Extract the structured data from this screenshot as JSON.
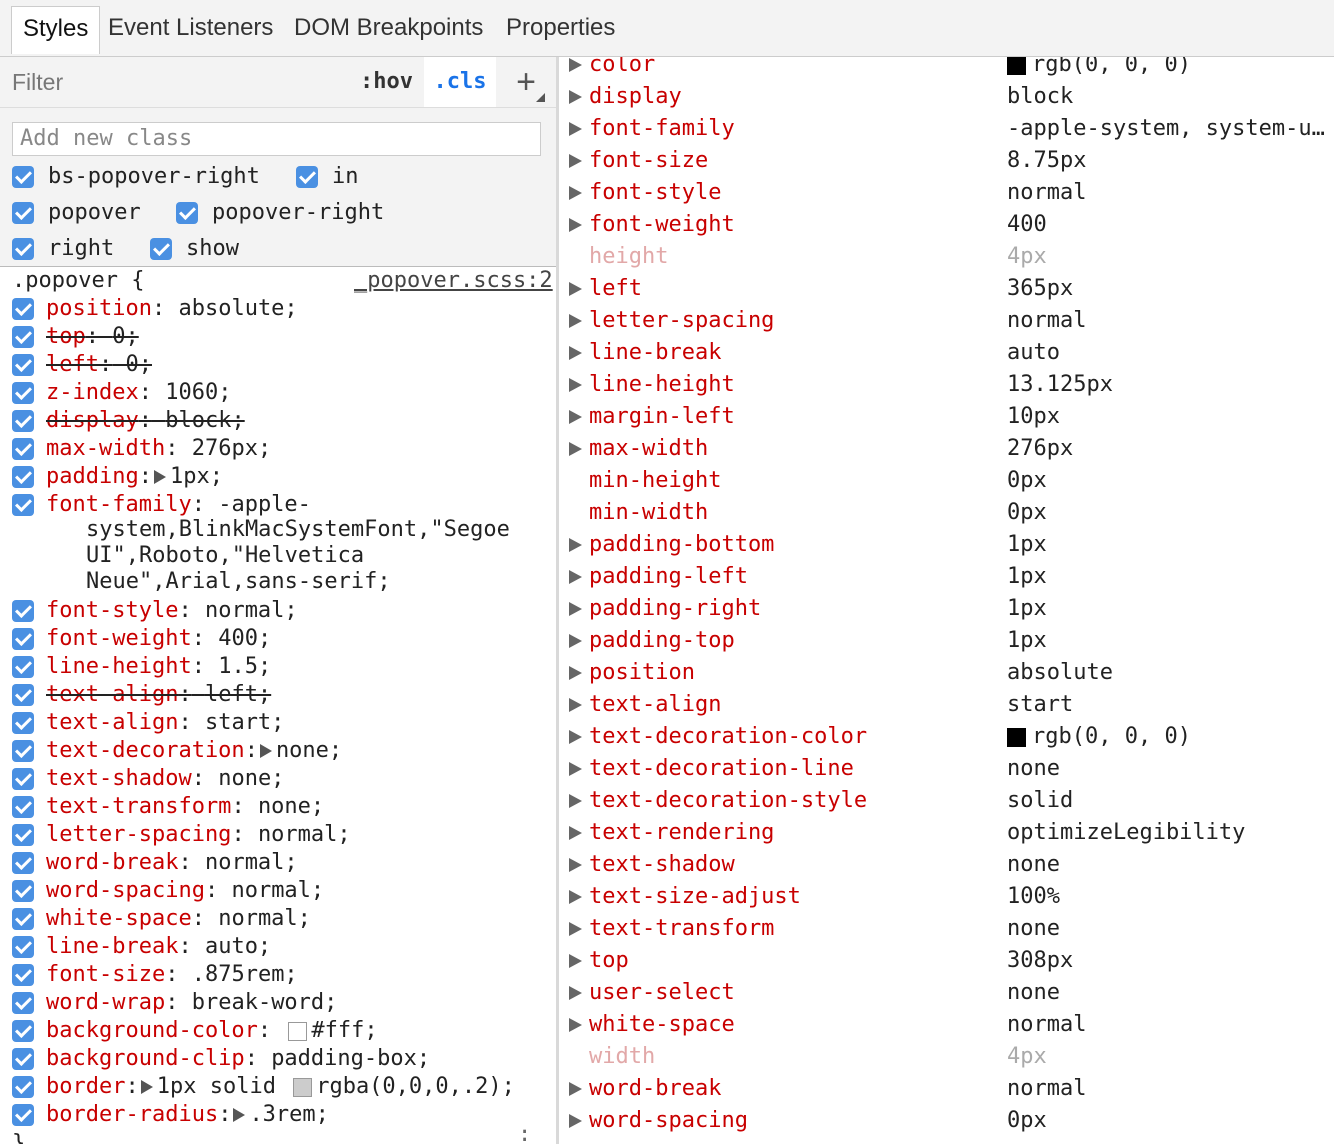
{
  "tabs": [
    {
      "label": "Styles",
      "active": true
    },
    {
      "label": "Event Listeners",
      "active": false
    },
    {
      "label": "DOM Breakpoints",
      "active": false
    },
    {
      "label": "Properties",
      "active": false
    }
  ],
  "toolbar": {
    "filter_placeholder": "Filter",
    "hov_label": ":hov",
    "cls_label": ".cls",
    "add_label": "+"
  },
  "class_pane": {
    "input_placeholder": "Add new class",
    "classes": [
      {
        "name": "bs-popover-right",
        "checked": true
      },
      {
        "name": "in",
        "checked": true
      },
      {
        "name": "popover",
        "checked": true
      },
      {
        "name": "popover-right",
        "checked": true
      },
      {
        "name": "right",
        "checked": true
      },
      {
        "name": "show",
        "checked": true
      }
    ]
  },
  "rule": {
    "selector": ".popover {",
    "source": "_popover.scss:2",
    "close": "}",
    "declarations": [
      {
        "name": "position",
        "value": "absolute;",
        "strike": false
      },
      {
        "name": "top",
        "value": "0;",
        "strike": true
      },
      {
        "name": "left",
        "value": "0;",
        "strike": true
      },
      {
        "name": "z-index",
        "value": "1060;",
        "strike": false
      },
      {
        "name": "display",
        "value": "block;",
        "strike": true
      },
      {
        "name": "max-width",
        "value": "276px;",
        "strike": false
      },
      {
        "name": "padding",
        "value": "1px;",
        "strike": false,
        "expand": true
      },
      {
        "name": "font-family",
        "value": "-apple-",
        "strike": false,
        "cont": [
          "system,BlinkMacSystemFont,\"Segoe",
          "UI\",Roboto,\"Helvetica",
          "Neue\",Arial,sans-serif;"
        ]
      },
      {
        "name": "font-style",
        "value": "normal;",
        "strike": false
      },
      {
        "name": "font-weight",
        "value": "400;",
        "strike": false
      },
      {
        "name": "line-height",
        "value": "1.5;",
        "strike": false
      },
      {
        "name": "text-align",
        "value": "left;",
        "strike": true
      },
      {
        "name": "text-align",
        "value": "start;",
        "strike": false
      },
      {
        "name": "text-decoration",
        "value": "none;",
        "strike": false,
        "expand": true
      },
      {
        "name": "text-shadow",
        "value": "none;",
        "strike": false
      },
      {
        "name": "text-transform",
        "value": "none;",
        "strike": false
      },
      {
        "name": "letter-spacing",
        "value": "normal;",
        "strike": false
      },
      {
        "name": "word-break",
        "value": "normal;",
        "strike": false
      },
      {
        "name": "word-spacing",
        "value": "normal;",
        "strike": false
      },
      {
        "name": "white-space",
        "value": "normal;",
        "strike": false
      },
      {
        "name": "line-break",
        "value": "auto;",
        "strike": false
      },
      {
        "name": "font-size",
        "value": ".875rem;",
        "strike": false
      },
      {
        "name": "word-wrap",
        "value": "break-word;",
        "strike": false
      },
      {
        "name": "background-color",
        "value": "#fff;",
        "strike": false,
        "swatch": "#ffffff"
      },
      {
        "name": "background-clip",
        "value": "padding-box;",
        "strike": false
      },
      {
        "name": "border",
        "value": "1px solid",
        "value2": "rgba(0,0,0,.2);",
        "strike": false,
        "expand": true,
        "swatch": "#cccccc"
      },
      {
        "name": "border-radius",
        "value": ".3rem;",
        "strike": false,
        "expand": true
      }
    ]
  },
  "computed": [
    {
      "name": "color",
      "value": "rgb(0, 0, 0)",
      "swatch": "#000000",
      "expandable": true
    },
    {
      "name": "display",
      "value": "block",
      "expandable": true
    },
    {
      "name": "font-family",
      "value": "-apple-system, system-u…",
      "expandable": true
    },
    {
      "name": "font-size",
      "value": "8.75px",
      "expandable": true
    },
    {
      "name": "font-style",
      "value": "normal",
      "expandable": true
    },
    {
      "name": "font-weight",
      "value": "400",
      "expandable": true
    },
    {
      "name": "height",
      "value": "4px",
      "expandable": false,
      "inherited": true
    },
    {
      "name": "left",
      "value": "365px",
      "expandable": true
    },
    {
      "name": "letter-spacing",
      "value": "normal",
      "expandable": true
    },
    {
      "name": "line-break",
      "value": "auto",
      "expandable": true
    },
    {
      "name": "line-height",
      "value": "13.125px",
      "expandable": true
    },
    {
      "name": "margin-left",
      "value": "10px",
      "expandable": true
    },
    {
      "name": "max-width",
      "value": "276px",
      "expandable": true
    },
    {
      "name": "min-height",
      "value": "0px",
      "expandable": false
    },
    {
      "name": "min-width",
      "value": "0px",
      "expandable": false
    },
    {
      "name": "padding-bottom",
      "value": "1px",
      "expandable": true
    },
    {
      "name": "padding-left",
      "value": "1px",
      "expandable": true
    },
    {
      "name": "padding-right",
      "value": "1px",
      "expandable": true
    },
    {
      "name": "padding-top",
      "value": "1px",
      "expandable": true
    },
    {
      "name": "position",
      "value": "absolute",
      "expandable": true
    },
    {
      "name": "text-align",
      "value": "start",
      "expandable": true
    },
    {
      "name": "text-decoration-color",
      "value": "rgb(0, 0, 0)",
      "swatch": "#000000",
      "expandable": true
    },
    {
      "name": "text-decoration-line",
      "value": "none",
      "expandable": true
    },
    {
      "name": "text-decoration-style",
      "value": "solid",
      "expandable": true
    },
    {
      "name": "text-rendering",
      "value": "optimizeLegibility",
      "expandable": true
    },
    {
      "name": "text-shadow",
      "value": "none",
      "expandable": true
    },
    {
      "name": "text-size-adjust",
      "value": "100%",
      "expandable": true
    },
    {
      "name": "text-transform",
      "value": "none",
      "expandable": true
    },
    {
      "name": "top",
      "value": "308px",
      "expandable": true
    },
    {
      "name": "user-select",
      "value": "none",
      "expandable": true
    },
    {
      "name": "white-space",
      "value": "normal",
      "expandable": true
    },
    {
      "name": "width",
      "value": "4px",
      "expandable": false,
      "inherited": true
    },
    {
      "name": "word-break",
      "value": "normal",
      "expandable": true
    },
    {
      "name": "word-spacing",
      "value": "0px",
      "expandable": true
    }
  ]
}
